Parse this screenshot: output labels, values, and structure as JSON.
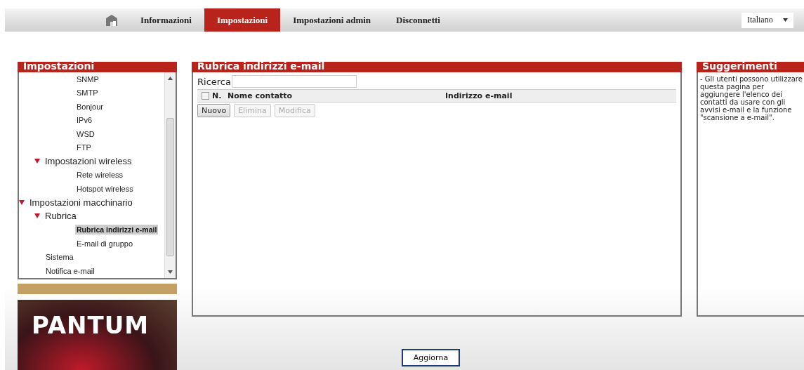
{
  "nav": {
    "tabs": [
      {
        "label": "Informazioni",
        "selected": false
      },
      {
        "label": "Impostazioni",
        "selected": true
      },
      {
        "label": "Impostazioni admin",
        "selected": false
      },
      {
        "label": "Disconnetti",
        "selected": false
      }
    ],
    "language": "Italiano"
  },
  "sidebar": {
    "title": "Impostazioni",
    "tree": [
      {
        "children": [
          {
            "children": [
              {
                "label": "SNMP",
                "selected": false
              },
              {
                "label": "SMTP",
                "selected": false
              },
              {
                "label": "Bonjour",
                "selected": false
              },
              {
                "label": "IPv6",
                "selected": false
              },
              {
                "label": "WSD",
                "selected": false
              },
              {
                "label": "FTP",
                "selected": false
              }
            ]
          },
          {
            "label": "Impostazioni wireless",
            "expanded": true,
            "children": [
              {
                "label": "Rete wireless",
                "selected": false
              },
              {
                "label": "Hotspot wireless",
                "selected": false
              }
            ]
          }
        ]
      },
      {
        "label": "Impostazioni macchinario",
        "expanded": true,
        "children": [
          {
            "label": "Rubrica",
            "expanded": true,
            "children": [
              {
                "label": "Rubrica indirizzi e-mail",
                "selected": true
              },
              {
                "label": "E-mail di gruppo",
                "selected": false
              }
            ]
          },
          {
            "label": "Sistema",
            "selected": false
          },
          {
            "label": "Notifica e-mail",
            "selected": false
          }
        ]
      }
    ],
    "logo": "PANTUM"
  },
  "main": {
    "title": "Rubrica indirizzi e-mail",
    "search_label": "Ricerca",
    "table": {
      "select_all_checked": false,
      "columns": [
        "N.",
        "Nome contatto",
        "Indirizzo e-mail"
      ]
    },
    "buttons": [
      {
        "label": "Nuovo",
        "disabled": false
      },
      {
        "label": "Elimina",
        "disabled": true
      },
      {
        "label": "Modifica",
        "disabled": true
      }
    ]
  },
  "tips": {
    "title": "Suggerimenti",
    "text": "- Gli utenti possono utilizzare questa pagina per aggiungere l'elenco dei contatti da usare con gli avvisi e-mail e la funzione \"scansione a e-mail\"."
  },
  "footer": {
    "button": "Aggiorna"
  }
}
